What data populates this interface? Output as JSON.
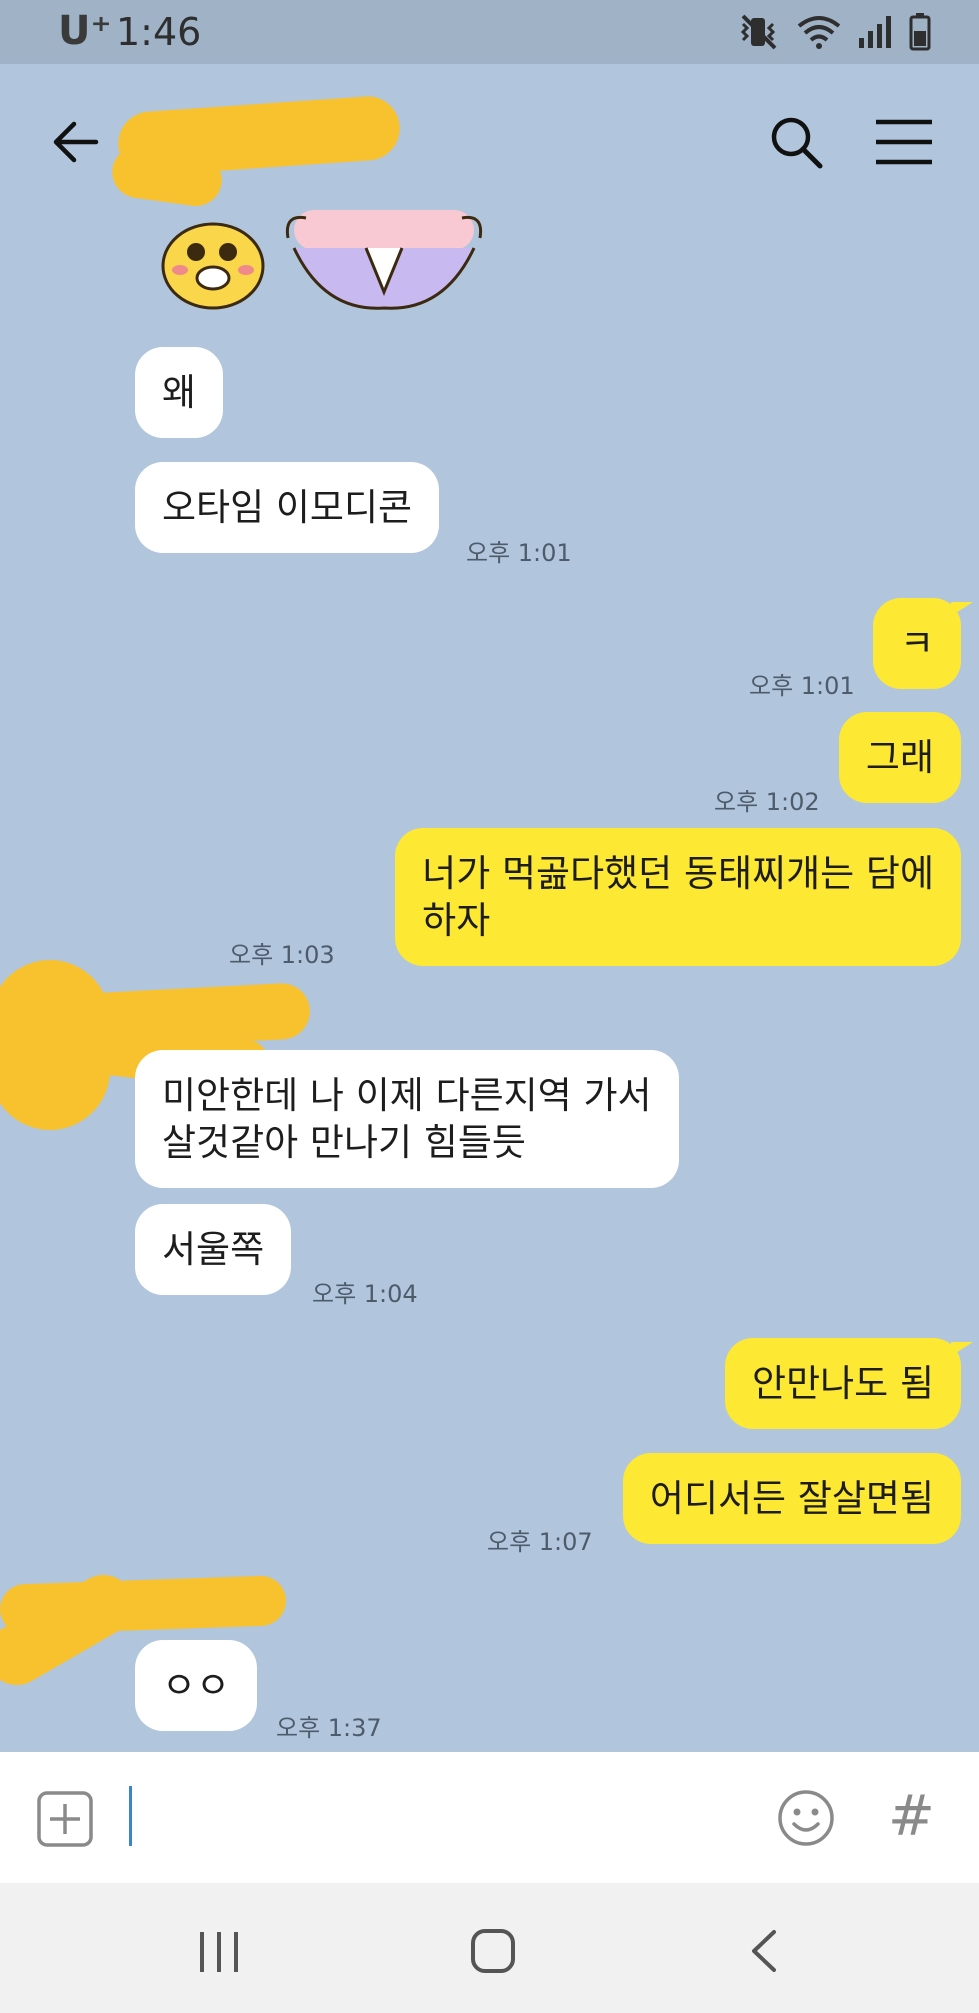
{
  "status_bar": {
    "carrier": "U⁺",
    "time": "1:46",
    "icons": [
      "vibrate-mute-icon",
      "wifi-icon",
      "signal-icon",
      "battery-icon"
    ]
  },
  "header": {
    "icons": [
      "back-arrow-icon",
      "search-icon",
      "menu-icon"
    ]
  },
  "messages": [
    {
      "dir": "in",
      "text": "왜",
      "time": ""
    },
    {
      "dir": "in",
      "text": "오타임 이모디콘",
      "time": "오후 1:01"
    },
    {
      "dir": "out",
      "text": "ㅋ",
      "time": "오후 1:01"
    },
    {
      "dir": "out",
      "text": "그래",
      "time": "오후 1:02"
    },
    {
      "dir": "out",
      "text": "너가 먹곮다했던  동태찌개는 담에\n하자",
      "time": "오후 1:03"
    },
    {
      "dir": "in",
      "text": "미안한데 나 이제 다른지역 가서\n살것같아 만나기 힘들듯",
      "time": ""
    },
    {
      "dir": "in",
      "text": "서울쪽",
      "time": "오후 1:04"
    },
    {
      "dir": "out",
      "text": "안만나도 됨",
      "time": ""
    },
    {
      "dir": "out",
      "text": "어디서든 잘살면됨",
      "time": "오후 1:07"
    },
    {
      "dir": "in",
      "text": "ㅇㅇ",
      "time": "오후 1:37"
    }
  ],
  "input": {
    "left_icon": "plus-box-icon",
    "right_icons": [
      "emoji-icon",
      "hashtag-icon"
    ],
    "hashtag_glyph": "#"
  },
  "nav": {
    "icons": [
      "recent-apps-icon",
      "home-icon",
      "back-icon"
    ]
  },
  "colors": {
    "background": "#b1c6dc",
    "sent_bubble": "#fde834",
    "received_bubble": "#ffffff",
    "redaction": "#f7c22e"
  }
}
